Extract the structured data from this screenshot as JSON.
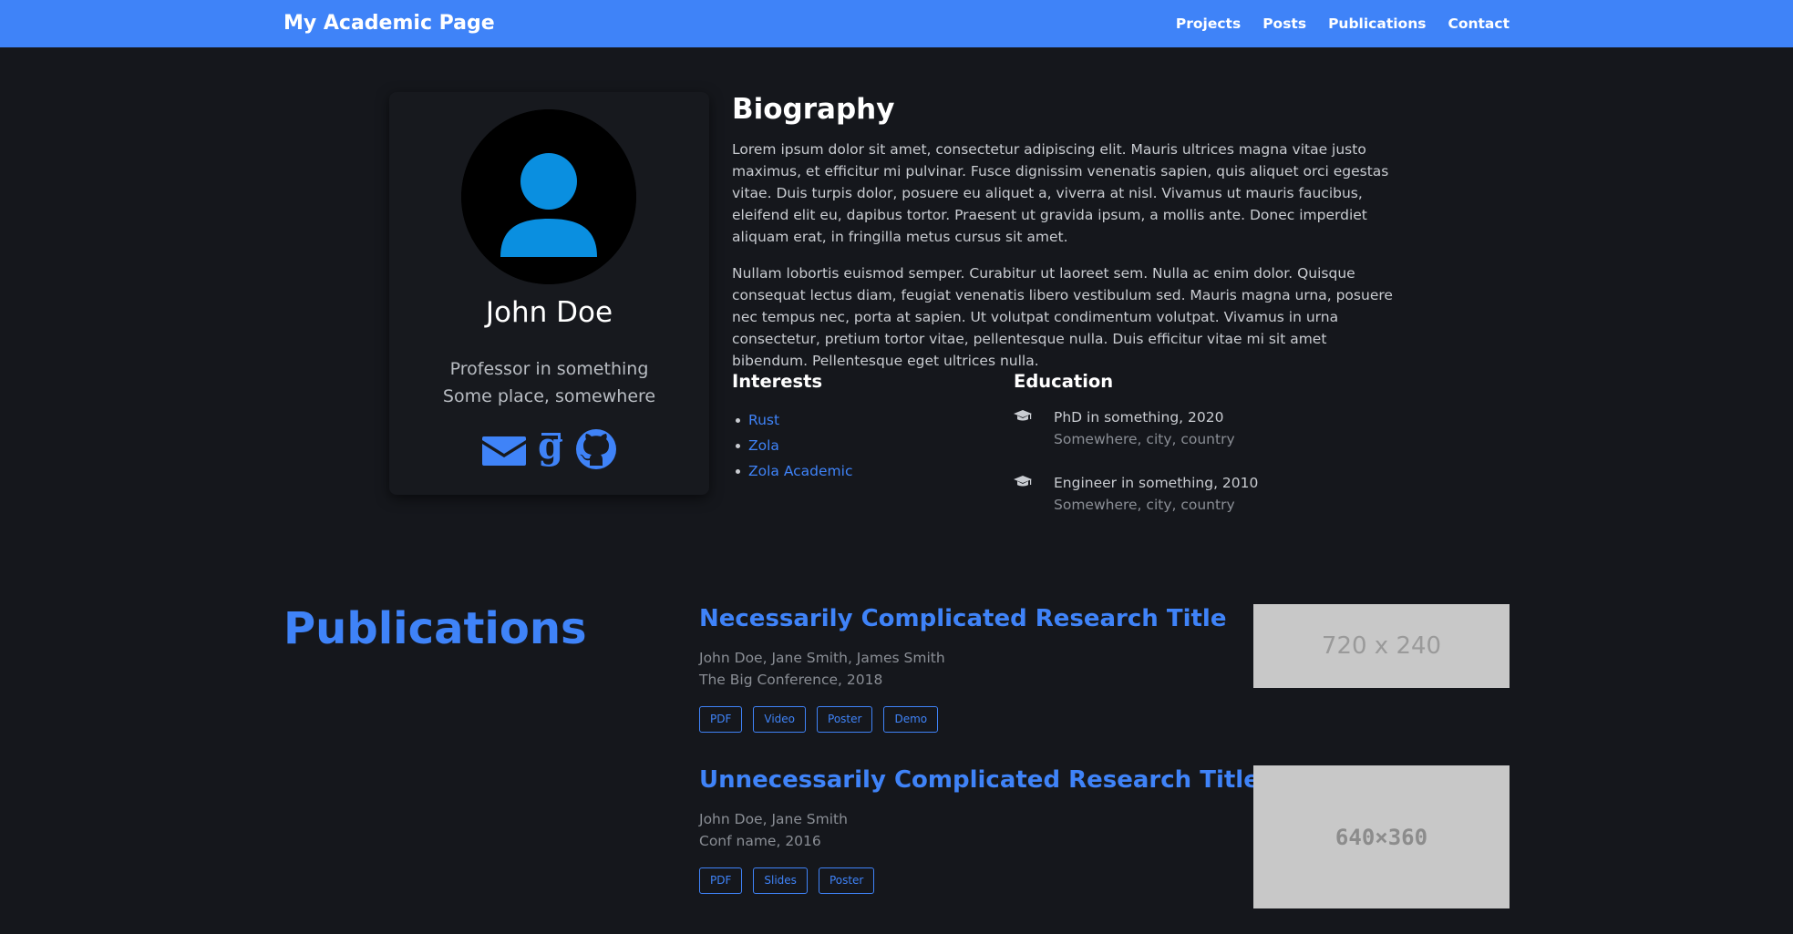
{
  "navbar": {
    "brand": "My Academic Page",
    "links": [
      "Projects",
      "Posts",
      "Publications",
      "Contact"
    ]
  },
  "profile": {
    "name": "John Doe",
    "role": "Professor in something",
    "place": "Some place, somewhere",
    "social_icons": [
      "envelope-icon",
      "google-scholar-icon",
      "github-icon"
    ]
  },
  "biography": {
    "title": "Biography",
    "paragraphs": [
      "Lorem ipsum dolor sit amet, consectetur adipiscing elit. Mauris ultrices magna vitae justo maximus, et efficitur mi pulvinar. Fusce dignissim venenatis sapien, quis aliquet orci egestas vitae. Duis turpis dolor, posuere eu aliquet a, viverra at nisl. Vivamus ut mauris faucibus, eleifend elit eu, dapibus tortor. Praesent ut gravida ipsum, a mollis ante. Donec imperdiet aliquam erat, in fringilla metus cursus sit amet.",
      "Nullam lobortis euismod semper. Curabitur ut laoreet sem. Nulla ac enim dolor. Quisque consequat lectus diam, feugiat venenatis libero vestibulum sed. Mauris magna urna, posuere nec tempus nec, porta at sapien. Ut volutpat condimentum volutpat. Vivamus in urna consectetur, pretium tortor vitae, pellentesque nulla. Duis efficitur vitae mi sit amet bibendum. Pellentesque eget ultrices nulla."
    ]
  },
  "interests": {
    "title": "Interests",
    "items": [
      "Rust",
      "Zola",
      "Zola Academic"
    ]
  },
  "education": {
    "title": "Education",
    "items": [
      {
        "degree": "PhD in something, 2020",
        "place": "Somewhere, city, country"
      },
      {
        "degree": "Engineer in something, 2010",
        "place": "Somewhere, city, country"
      }
    ]
  },
  "publications": {
    "title": "Publications",
    "items": [
      {
        "title": "Necessarily Complicated Research Title",
        "authors": "John Doe, Jane Smith, James Smith",
        "venue": "The Big Conference, 2018",
        "buttons": [
          "PDF",
          "Video",
          "Poster",
          "Demo"
        ],
        "thumb_label": "720 x 240"
      },
      {
        "title": "Unnecessarily Complicated Research Title",
        "authors": "John Doe, Jane Smith",
        "venue": "Conf name, 2016",
        "buttons": [
          "PDF",
          "Slides",
          "Poster"
        ],
        "thumb_label": "640×360"
      }
    ]
  },
  "colors": {
    "accent": "#3f83f8",
    "background": "#15171c",
    "avatar_figure": "#0a8fe0"
  }
}
